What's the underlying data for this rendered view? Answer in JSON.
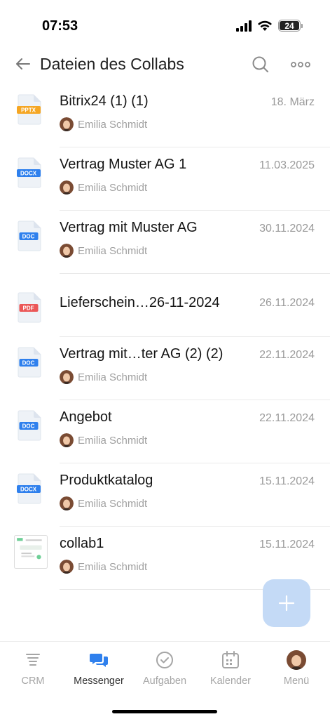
{
  "status": {
    "time": "07:53",
    "battery": "24"
  },
  "header": {
    "title": "Dateien des Collabs"
  },
  "files": [
    {
      "name": "Bitrix24 (1) (1)",
      "date": "18. März",
      "owner": "Emilia Schmidt",
      "type": "PPTX",
      "color": "#f5a623"
    },
    {
      "name": "Vertrag Muster AG 1",
      "date": "11.03.2025",
      "owner": "Emilia Schmidt",
      "type": "DOCX",
      "color": "#2f80ed"
    },
    {
      "name": "Vertrag mit Muster AG",
      "date": "30.11.2024",
      "owner": "Emilia Schmidt",
      "type": "DOC",
      "color": "#2f80ed"
    },
    {
      "name": "Lieferschein…26-11-2024",
      "date": "26.11.2024",
      "owner": "",
      "type": "PDF",
      "color": "#eb5757"
    },
    {
      "name": "Vertrag mit…ter AG (2) (2)",
      "date": "22.11.2024",
      "owner": "Emilia Schmidt",
      "type": "DOC",
      "color": "#2f80ed"
    },
    {
      "name": "Angebot",
      "date": "22.11.2024",
      "owner": "Emilia Schmidt",
      "type": "DOC",
      "color": "#2f80ed"
    },
    {
      "name": "Produktkatalog",
      "date": "15.11.2024",
      "owner": "Emilia Schmidt",
      "type": "DOCX",
      "color": "#2f80ed"
    },
    {
      "name": "collab1",
      "date": "15.11.2024",
      "owner": "Emilia Schmidt",
      "type": "image",
      "color": "#6fcf97"
    }
  ],
  "tabs": [
    {
      "label": "CRM",
      "icon": "crm-icon"
    },
    {
      "label": "Messenger",
      "icon": "messenger-icon",
      "active": true
    },
    {
      "label": "Aufgaben",
      "icon": "tasks-icon"
    },
    {
      "label": "Kalender",
      "icon": "calendar-icon"
    },
    {
      "label": "Menü",
      "icon": "avatar"
    }
  ],
  "colors": {
    "accent": "#2f80ed",
    "fab": "#c4daf6"
  }
}
